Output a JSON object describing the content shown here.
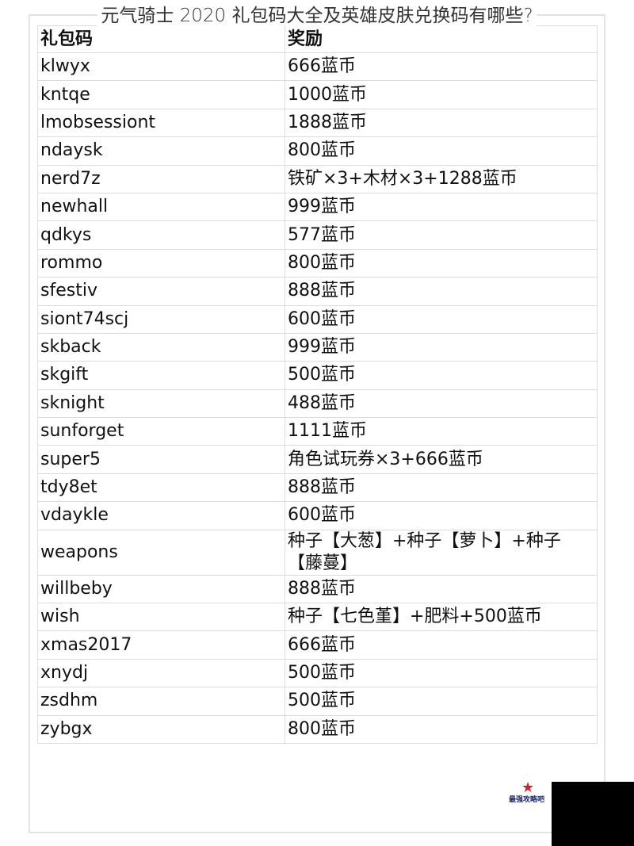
{
  "page": {
    "title": "元气骑士 2020 礼包码大全及英雄皮肤兑换码有哪些?"
  },
  "table": {
    "headers": [
      "礼包码",
      "奖励"
    ],
    "rows": [
      {
        "code": "klwyx",
        "reward": "666蓝币"
      },
      {
        "code": "kntqe",
        "reward": "1000蓝币"
      },
      {
        "code": "lmobsessiont",
        "reward": "1888蓝币"
      },
      {
        "code": "ndaysk",
        "reward": "800蓝币"
      },
      {
        "code": "nerd7z",
        "reward": "铁矿×3+木材×3+1288蓝币"
      },
      {
        "code": "newhall",
        "reward": "999蓝币"
      },
      {
        "code": "qdkys",
        "reward": "577蓝币"
      },
      {
        "code": "rommo",
        "reward": "800蓝币"
      },
      {
        "code": "sfestiv",
        "reward": "888蓝币"
      },
      {
        "code": "siont74scj",
        "reward": "600蓝币"
      },
      {
        "code": "skback",
        "reward": "999蓝币"
      },
      {
        "code": "skgift",
        "reward": "500蓝币"
      },
      {
        "code": "sknight",
        "reward": "488蓝币"
      },
      {
        "code": "sunforget",
        "reward": "1111蓝币"
      },
      {
        "code": "super5",
        "reward": "角色试玩券×3+666蓝币"
      },
      {
        "code": "tdy8et",
        "reward": "888蓝币"
      },
      {
        "code": "vdaykle",
        "reward": "600蓝币"
      },
      {
        "code": "weapons",
        "reward": "种子【大葱】+种子【萝卜】+种子【藤蔓】"
      },
      {
        "code": "willbeby",
        "reward": "888蓝币"
      },
      {
        "code": "wish",
        "reward": "种子【七色堇】+肥料+500蓝币"
      },
      {
        "code": "xmas2017",
        "reward": "666蓝币"
      },
      {
        "code": "xnydj",
        "reward": "500蓝币"
      },
      {
        "code": "zsdhm",
        "reward": "500蓝币"
      },
      {
        "code": "zybgx",
        "reward": "800蓝币"
      }
    ]
  },
  "watermark": {
    "icon": "star-logo-icon",
    "text": "最强攻略吧"
  }
}
